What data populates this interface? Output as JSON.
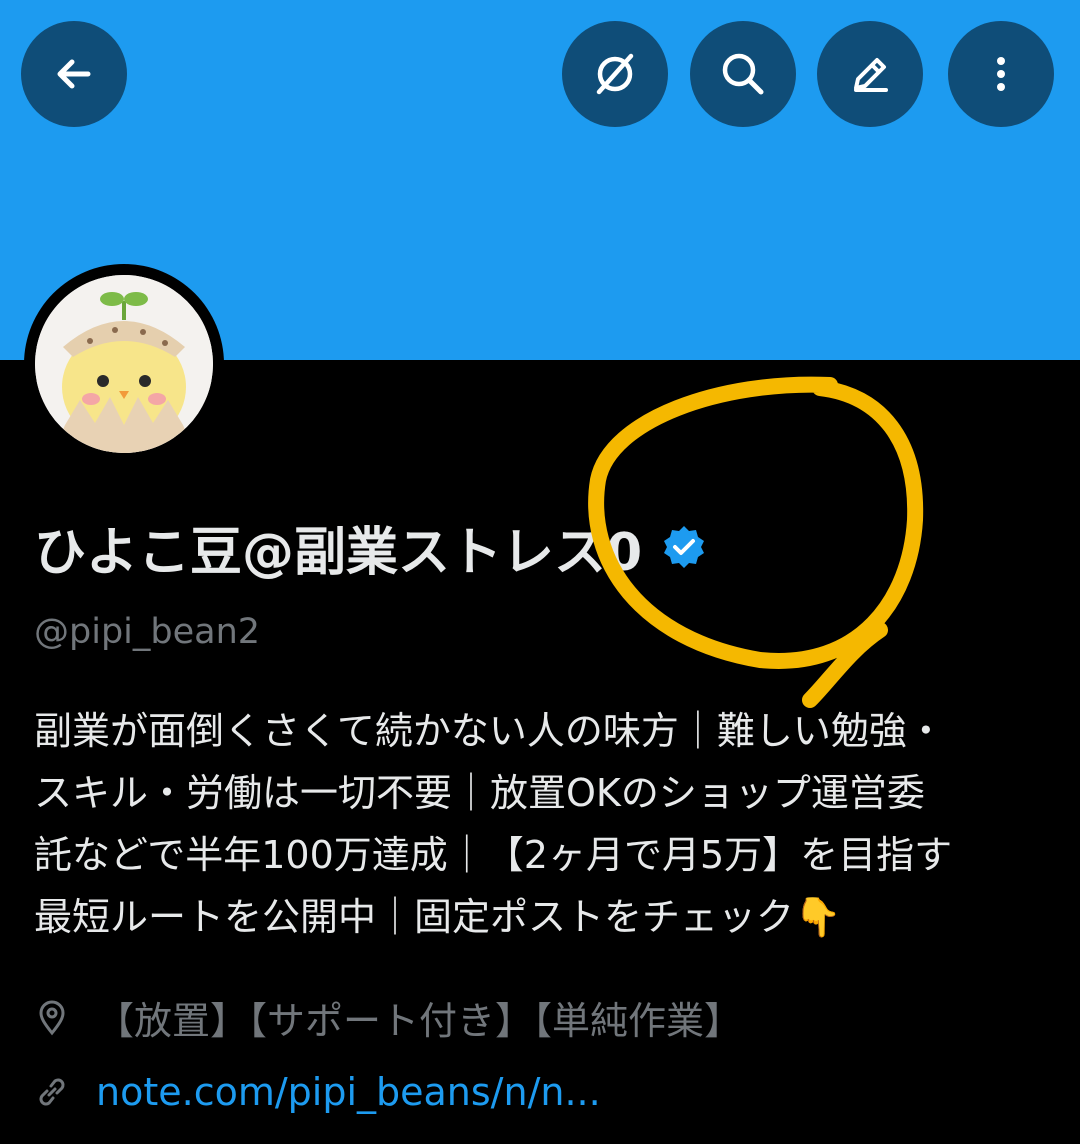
{
  "colors": {
    "banner": "#1d9bf0",
    "header_button": "#0f4d78",
    "link": "#1d9bf0",
    "secondary_text": "#71767b",
    "annotation": "#f5b800"
  },
  "header": {
    "icons": [
      "back-arrow-icon",
      "no-sensitive-icon",
      "search-icon",
      "edit-pencil-icon",
      "more-vertical-icon"
    ]
  },
  "profile": {
    "display_name": "ひよこ豆@副業ストレス0",
    "verified_icon": "verified-badge-icon",
    "handle": "@pipi_bean2",
    "bio_lines": [
      "副業が面倒くさくて続かない人の味方｜難しい勉強・",
      "スキル・労働は一切不要｜放置OKのショップ運営委",
      "託などで半年100万達成｜【2ヶ月で月5万】を目指す",
      "最短ルートを公開中｜固定ポストをチェック👇"
    ],
    "location": "【放置】【サポート付き】【単純作業】",
    "website": "note.com/pipi_beans/n/n..."
  }
}
